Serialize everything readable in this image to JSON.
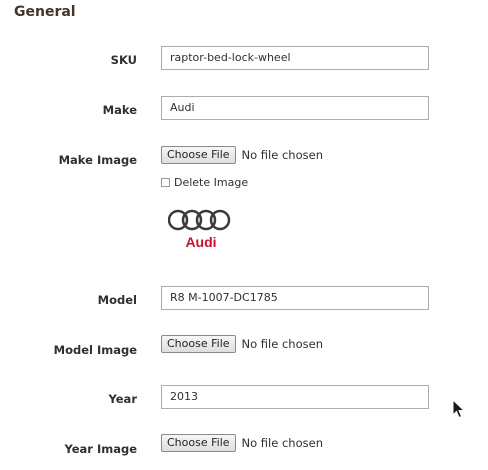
{
  "section": {
    "title": "General"
  },
  "fields": {
    "sku": {
      "label": "SKU",
      "value": "raptor-bed-lock-wheel"
    },
    "make": {
      "label": "Make",
      "value": "Audi"
    },
    "make_image": {
      "label": "Make Image",
      "button": "Choose File",
      "status": "No file chosen",
      "delete_label": "Delete Image",
      "logo_text": "Audi",
      "logo_color": "#c8102e"
    },
    "model": {
      "label": "Model",
      "value": "R8 M-1007-DC1785"
    },
    "model_image": {
      "label": "Model Image",
      "button": "Choose File",
      "status": "No file chosen"
    },
    "year": {
      "label": "Year",
      "value": "2013"
    },
    "year_image": {
      "label": "Year Image",
      "button": "Choose File",
      "status": "No file chosen"
    }
  }
}
